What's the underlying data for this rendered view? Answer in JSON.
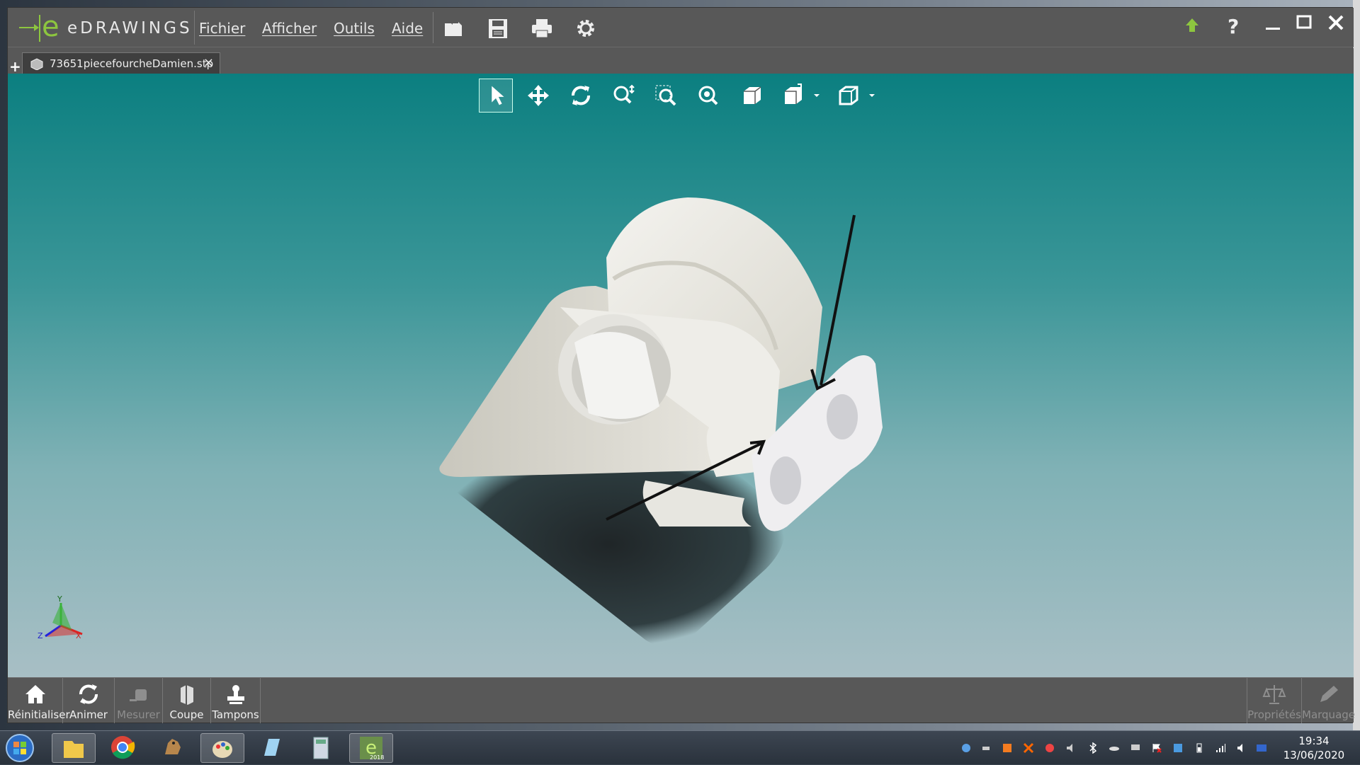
{
  "app": {
    "title": "eDRAWINGS"
  },
  "menu": [
    "Fichier",
    "Afficher",
    "Outils",
    "Aide"
  ],
  "tab": {
    "filename": "73651piecefourcheDamien.stp",
    "close": "×",
    "new": "+"
  },
  "bottom_left": [
    "Réinitialiser",
    "Animer",
    "Mesurer",
    "Coupe",
    "Tampons"
  ],
  "bottom_right": [
    "Propriétés",
    "Marquage"
  ],
  "triad": {
    "x": "X",
    "y": "Y",
    "z": "Z"
  },
  "clock": {
    "time": "19:34",
    "date": "13/06/2020"
  },
  "colors": {
    "viewport_top": "#0b7f80",
    "viewport_bottom": "#a8bfc5",
    "logo_green": "#8dc63f",
    "ui_gray": "#585858"
  },
  "icons": {
    "toolbar": [
      "open-folder-icon",
      "save-icon",
      "print-icon",
      "settings-gear-icon"
    ],
    "window": [
      "upload-arrow-icon",
      "help-icon",
      "minimize-icon",
      "maximize-icon",
      "close-icon"
    ],
    "view": [
      "select-arrow-icon",
      "pan-icon",
      "rotate-icon",
      "zoom-fit-icon",
      "zoom-area-icon",
      "zoom-icon",
      "view-cube-icon",
      "display-style-icon",
      "views-icon"
    ],
    "taskbar": [
      "start-orb-icon",
      "file-explorer-icon",
      "chrome-icon",
      "dog-app-icon",
      "paint-icon",
      "notepad-icon",
      "calculator-icon",
      "edrawings-2018-icon"
    ]
  }
}
